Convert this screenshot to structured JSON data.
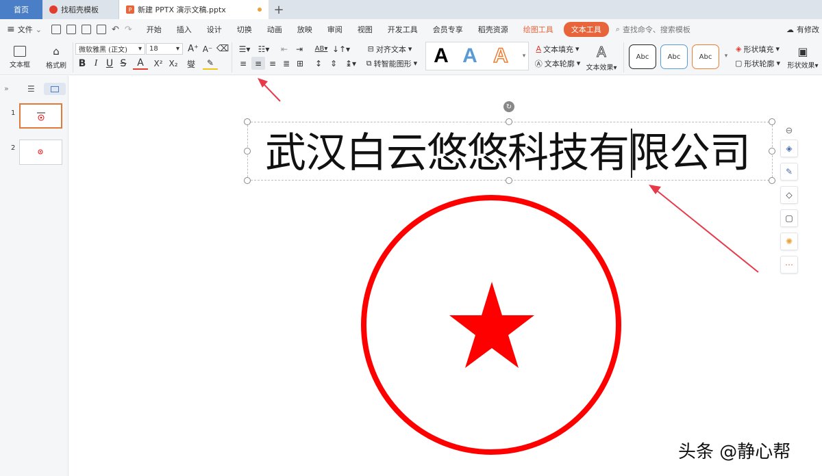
{
  "tabs": {
    "home": "首页",
    "template": "找稻壳模板",
    "document": "新建 PPTX 演示文稿.pptx",
    "add": "+"
  },
  "menu": {
    "file": "文件",
    "items": [
      "开始",
      "插入",
      "设计",
      "切换",
      "动画",
      "放映",
      "审阅",
      "视图",
      "开发工具",
      "会员专享",
      "稻壳资源"
    ],
    "drawing_tools": "绘图工具",
    "text_tools": "文本工具",
    "search_placeholder": "查找命令、搜索模板",
    "cloud": "有修改"
  },
  "ribbon": {
    "textbox": "文本框",
    "format_painter": "格式刷",
    "font": "微软雅黑 (正文)",
    "size": "18",
    "align_text": "对齐文本",
    "smart_shape": "转智能图形",
    "text_fill": "文本填充",
    "text_outline": "文本轮廓",
    "text_effect": "文本效果",
    "shape_fill": "形状填充",
    "shape_outline": "形状轮廓",
    "shape_effect": "形状效果",
    "abc": "Abc",
    "bold": "B",
    "italic": "I",
    "underline": "U",
    "strike": "S",
    "font_color": "A",
    "superscript": "X²",
    "subscript": "X₂",
    "phonetic": "燮",
    "big_a": "A"
  },
  "slides": [
    {
      "number": "1"
    },
    {
      "number": "2"
    }
  ],
  "canvas": {
    "title": "武汉白云悠悠科技有限公司"
  },
  "watermark": "头条 @静心帮",
  "colors": {
    "accent": "#e8643a",
    "seal_red": "#ff0000",
    "arrow_red": "#e8394a",
    "home_tab": "#4a7fc8"
  }
}
